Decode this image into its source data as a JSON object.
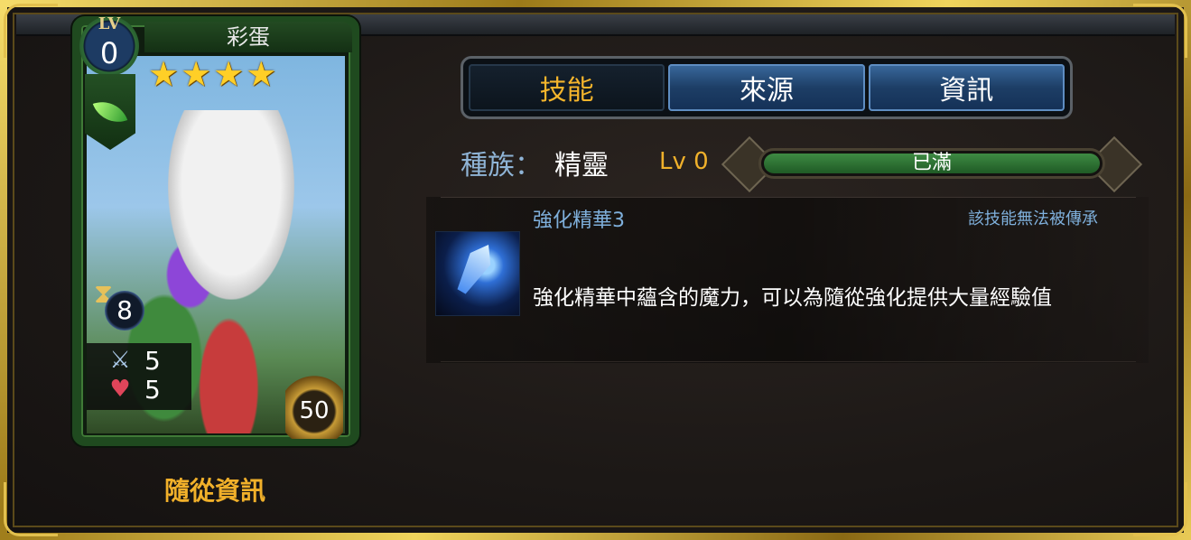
{
  "card": {
    "name": "彩蛋",
    "lv_label": "LV",
    "level": "0",
    "stars": 4,
    "cost": "8",
    "attack": "5",
    "hp": "5",
    "gold": "50",
    "companion_info": "隨從資訊"
  },
  "tabs": [
    {
      "label": "技能",
      "active": true
    },
    {
      "label": "來源",
      "active": false
    },
    {
      "label": "資訊",
      "active": false
    }
  ],
  "race": {
    "label": "種族：",
    "value": "精靈"
  },
  "skill_level": "Lv 0",
  "exp_bar": {
    "text": "已滿",
    "fill": 1.0
  },
  "skill": {
    "name": "強化精華3",
    "note": "該技能無法被傳承",
    "description": "強化精華中蘊含的魔力，可以為隨從強化提供大量經驗值"
  },
  "icons": {
    "attribute": "leaf-icon",
    "cost": "hourglass-icon",
    "attack": "crossed-swords-icon",
    "hp": "heart-icon",
    "gold": "gold-crest-icon"
  },
  "colors": {
    "gold_text": "#f1b02a",
    "blue_text": "#7fb0dc",
    "tab_blue": "#1d3e66",
    "exp_green": "#3e8a43",
    "frame_gold": "#c9a531"
  }
}
